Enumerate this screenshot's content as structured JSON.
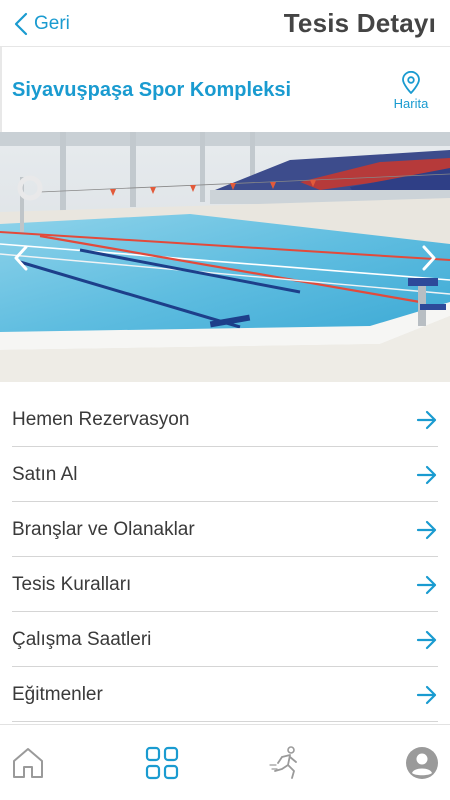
{
  "nav": {
    "back_label": "Geri",
    "title": "Tesis Detayı"
  },
  "facility": {
    "name": "Siyavuşpaşa Spor Kompleksi",
    "map_label": "Harita"
  },
  "menu": {
    "items": [
      {
        "label": "Hemen Rezervasyon"
      },
      {
        "label": "Satın Al"
      },
      {
        "label": "Branşlar ve Olanaklar"
      },
      {
        "label": "Tesis Kuralları"
      },
      {
        "label": "Çalışma Saatleri"
      },
      {
        "label": "Eğitmenler"
      }
    ]
  },
  "tabbar": {
    "items": [
      {
        "icon": "home-icon",
        "active": false
      },
      {
        "icon": "grid-icon",
        "active": true
      },
      {
        "icon": "running-person-icon",
        "active": false
      },
      {
        "icon": "user-avatar-icon",
        "active": false
      }
    ]
  },
  "colors": {
    "accent": "#1a9bd0",
    "inactive_icon": "#9a9a9a",
    "title_text": "#444444",
    "divider": "#d5d5d5"
  }
}
